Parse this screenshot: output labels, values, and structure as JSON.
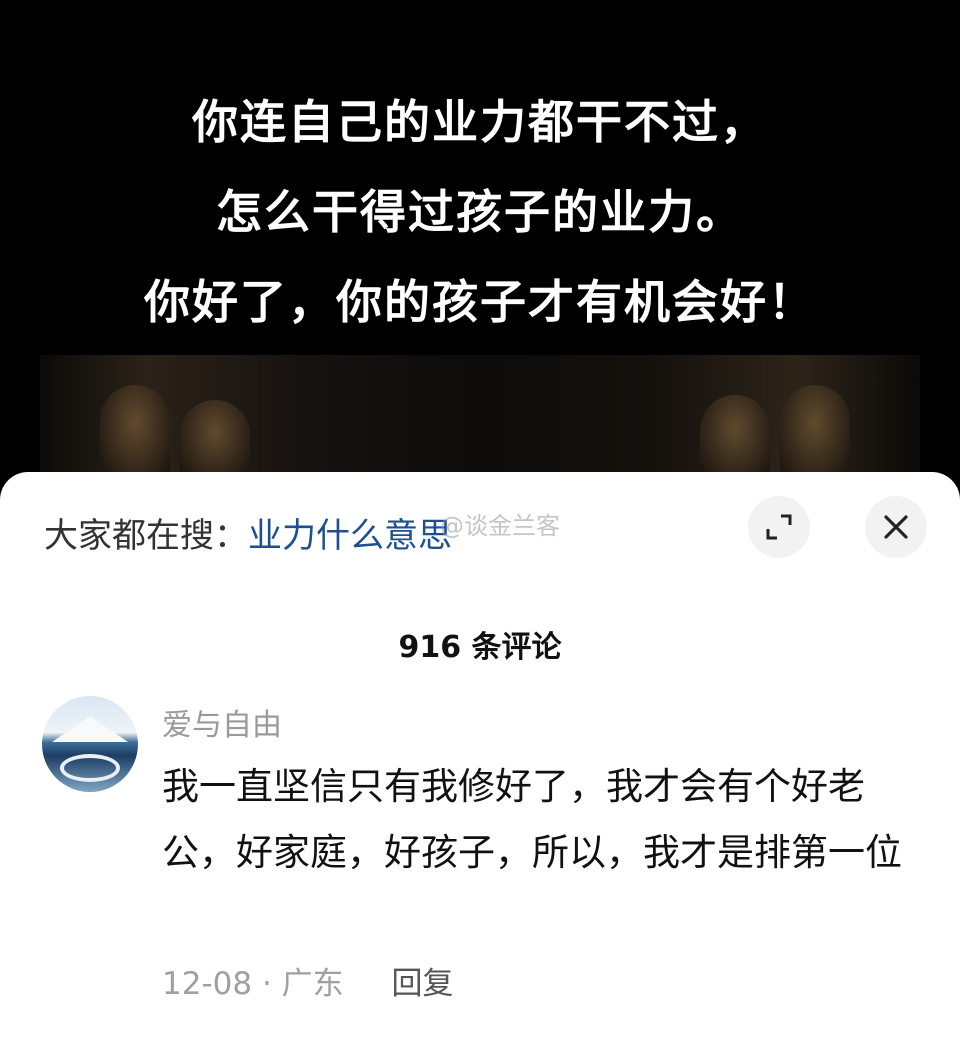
{
  "video": {
    "caption_lines": [
      "你连自己的业力都干不过，",
      "怎么干得过孩子的业力。",
      "你好了，你的孩子才有机会好！"
    ]
  },
  "search_bar": {
    "prefix": "大家都在搜：",
    "term": "业力什么意思"
  },
  "watermark": "@谈金兰客",
  "icons": {
    "expand": "expand-icon",
    "close": "close-icon"
  },
  "comments": {
    "count_label": "916 条评论",
    "items": [
      {
        "username": "爱与自由",
        "text": "我一直坚信只有我修好了，我才会有个好老公，好家庭，好孩子，所以，我才是排第一位",
        "date": "12-08",
        "location": "广东",
        "reply_label": "回复"
      }
    ]
  },
  "colors": {
    "link_blue": "#1d4f91",
    "sheet_bg": "#ffffff",
    "meta_gray": "#a0a0a0"
  }
}
